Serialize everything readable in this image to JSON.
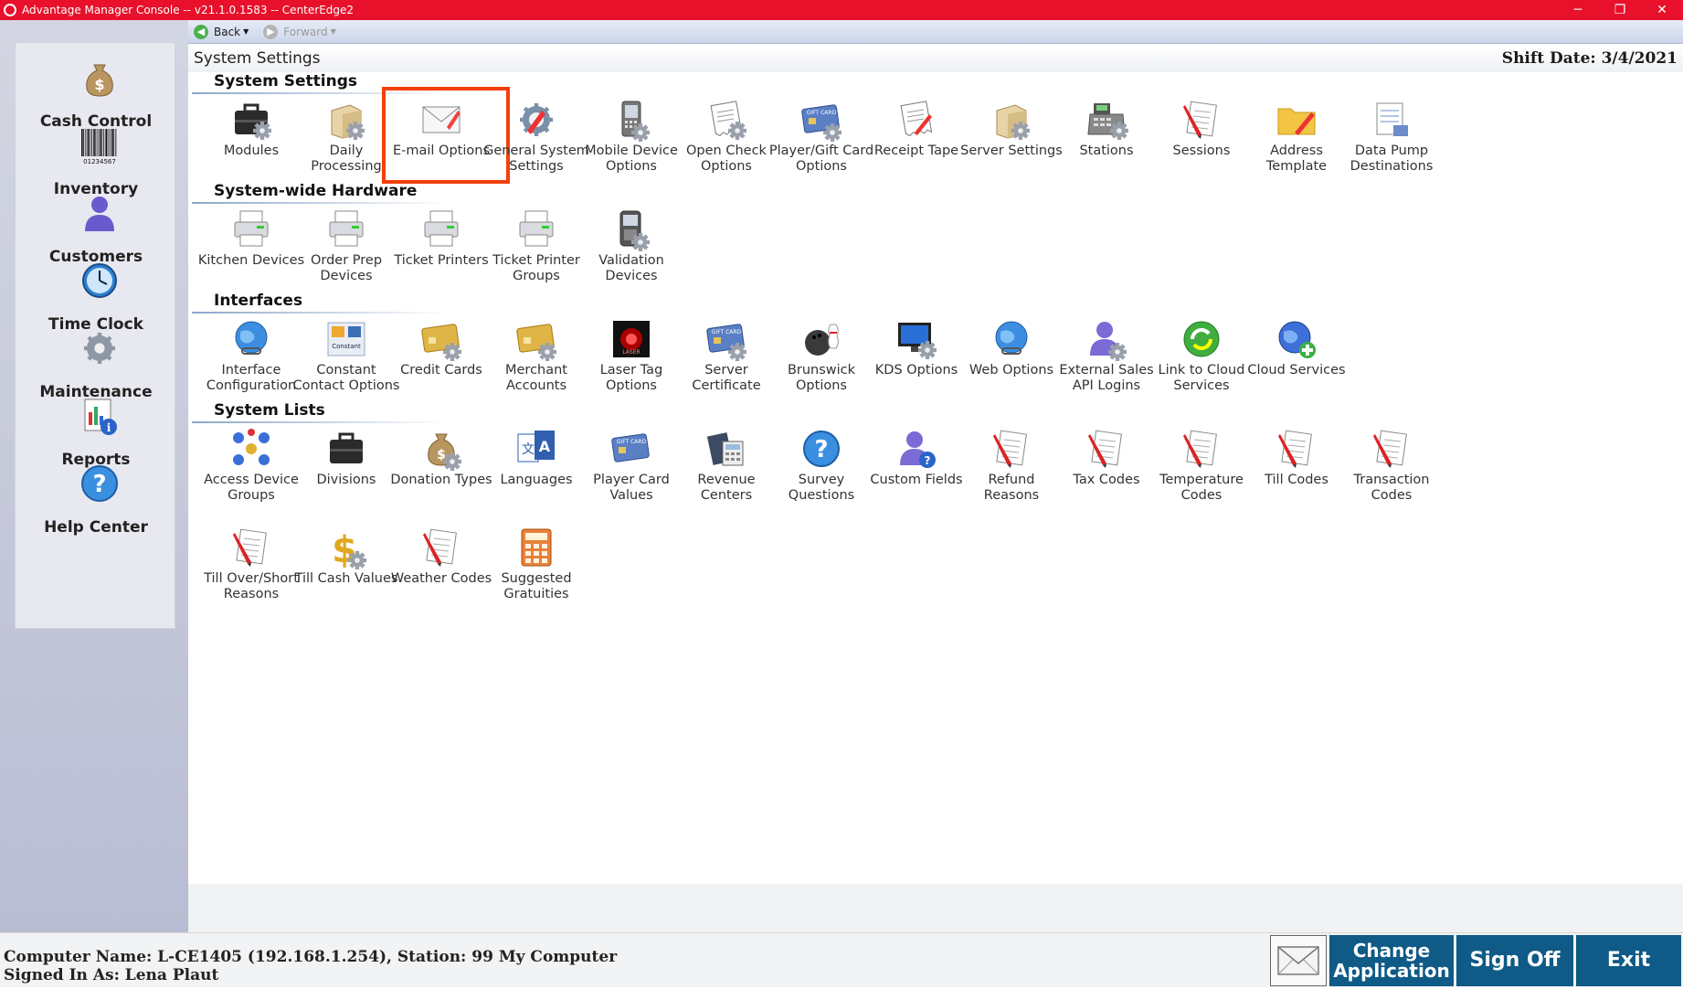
{
  "titlebar": {
    "title": "Advantage Manager Console -- v21.1.0.1583 -- CenterEdge2",
    "minimize": "─",
    "restore": "❐",
    "close": "✕"
  },
  "toolbar": {
    "back": "Back",
    "forward": "Forward"
  },
  "header": {
    "page_title": "System Settings",
    "shift_date": "Shift Date: 3/4/2021"
  },
  "nav": [
    {
      "label": "Cash Control",
      "icon": "money-bag-icon"
    },
    {
      "label": "Inventory",
      "icon": "barcode-icon"
    },
    {
      "label": "Customers",
      "icon": "person-icon"
    },
    {
      "label": "Time Clock",
      "icon": "clock-icon"
    },
    {
      "label": "Maintenance",
      "icon": "gear-icon"
    },
    {
      "label": "Reports",
      "icon": "report-icon"
    },
    {
      "label": "Help Center",
      "icon": "help-icon"
    }
  ],
  "sections": {
    "system_settings": {
      "title": "System Settings",
      "items": [
        {
          "label": "Modules",
          "icon": "briefcase-gear-icon"
        },
        {
          "label": "Daily\nProcessing",
          "icon": "box-gear-icon"
        },
        {
          "label": "E-mail Options",
          "icon": "envelope-icon"
        },
        {
          "label": "General System\nSettings",
          "icon": "gear-pencil-icon"
        },
        {
          "label": "Mobile Device\nOptions",
          "icon": "mobile-device-icon"
        },
        {
          "label": "Open Check\nOptions",
          "icon": "receipt-gear-icon"
        },
        {
          "label": "Player/Gift Card\nOptions",
          "icon": "gift-card-gear-icon"
        },
        {
          "label": "Receipt Tape",
          "icon": "receipt-icon"
        },
        {
          "label": "Server Settings",
          "icon": "box-gear-icon"
        },
        {
          "label": "Stations",
          "icon": "register-icon"
        },
        {
          "label": "Sessions",
          "icon": "session-list-icon"
        },
        {
          "label": "Address\nTemplate",
          "icon": "folder-pencil-icon"
        },
        {
          "label": "Data Pump\nDestinations",
          "icon": "data-pump-icon"
        }
      ]
    },
    "hardware": {
      "title": "System-wide Hardware",
      "items": [
        {
          "label": "Kitchen Devices",
          "icon": "printer-icon"
        },
        {
          "label": "Order Prep\nDevices",
          "icon": "printer-icon"
        },
        {
          "label": "Ticket Printers",
          "icon": "printer-icon"
        },
        {
          "label": "Ticket Printer\nGroups",
          "icon": "printer-icon"
        },
        {
          "label": "Validation\nDevices",
          "icon": "validation-device-icon"
        }
      ]
    },
    "interfaces": {
      "title": "Interfaces",
      "items": [
        {
          "label": "Interface\nConfiguration",
          "icon": "globe-link-icon"
        },
        {
          "label": "Constant\nContact Options",
          "icon": "constant-contact-icon"
        },
        {
          "label": "Credit Cards",
          "icon": "credit-card-gear-icon"
        },
        {
          "label": "Merchant\nAccounts",
          "icon": "credit-card-gear-icon"
        },
        {
          "label": "Laser Tag\nOptions",
          "icon": "laser-tag-icon"
        },
        {
          "label": "Server\nCertificate",
          "icon": "certificate-card-icon"
        },
        {
          "label": "Brunswick\nOptions",
          "icon": "bowling-icon"
        },
        {
          "label": "KDS Options",
          "icon": "monitor-gear-icon"
        },
        {
          "label": "Web Options",
          "icon": "globe-link-icon"
        },
        {
          "label": "External Sales\nAPI Logins",
          "icon": "person-gear-icon"
        },
        {
          "label": "Link to Cloud\nServices",
          "icon": "cloud-sync-icon"
        },
        {
          "label": "Cloud Services",
          "icon": "globe-plus-icon"
        }
      ]
    },
    "lists": {
      "title": "System Lists",
      "items": [
        {
          "label": "Access Device\nGroups",
          "icon": "group-icon"
        },
        {
          "label": "Divisions",
          "icon": "briefcase-icon"
        },
        {
          "label": "Donation Types",
          "icon": "money-bag-gear-icon"
        },
        {
          "label": "Languages",
          "icon": "language-icon"
        },
        {
          "label": "Player Card\nValues",
          "icon": "gift-card-icon"
        },
        {
          "label": "Revenue\nCenters",
          "icon": "calculator-book-icon"
        },
        {
          "label": "Survey\nQuestions",
          "icon": "question-icon"
        },
        {
          "label": "Custom Fields",
          "icon": "person-question-icon"
        },
        {
          "label": "Refund\nReasons",
          "icon": "list-pencil-icon"
        },
        {
          "label": "Tax Codes",
          "icon": "list-pencil-icon"
        },
        {
          "label": "Temperature\nCodes",
          "icon": "list-pencil-icon"
        },
        {
          "label": "Till Codes",
          "icon": "list-pencil-icon"
        },
        {
          "label": "Transaction\nCodes",
          "icon": "list-pencil-icon"
        },
        {
          "label": "Till Over/Short\nReasons",
          "icon": "list-pencil-icon"
        },
        {
          "label": "Till Cash Values",
          "icon": "dollar-gear-icon"
        },
        {
          "label": "Weather Codes",
          "icon": "list-pencil-icon"
        },
        {
          "label": "Suggested\nGratuities",
          "icon": "calculator-icon"
        }
      ]
    }
  },
  "status": {
    "computer": "Computer Name: L-CE1405 (192.168.1.254), Station: 99 My Computer",
    "signed_in": "Signed In As: Lena Plaut"
  },
  "buttons": {
    "change_app": "Change\nApplication",
    "sign_off": "Sign Off",
    "exit": "Exit"
  },
  "colors": {
    "titlebar": "#e8102a",
    "action_button": "#0f5a86",
    "selection": "#f2400a"
  }
}
